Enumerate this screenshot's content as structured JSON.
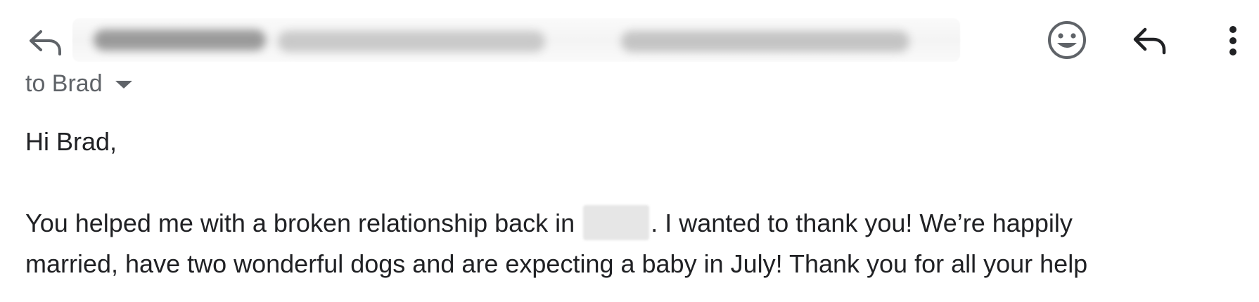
{
  "header": {
    "reply_icon": "reply-arrow-icon",
    "emoji_icon": "smiley-icon",
    "reply_icon_right": "reply-arrow-icon",
    "more_icon": "vertical-ellipsis-icon",
    "sender_redacted": true
  },
  "recipient": {
    "label": "to Brad"
  },
  "message": {
    "greeting": "Hi Brad,",
    "line1_before": "You helped me with a broken relationship back in",
    "line1_after": ". I wanted to thank you! We’re happily",
    "line2": "married, have two wonderful dogs and are expecting a baby in July! Thank you for all your help"
  },
  "colors": {
    "text": "#202124",
    "muted": "#5f6368",
    "icon": "#5f6368"
  }
}
